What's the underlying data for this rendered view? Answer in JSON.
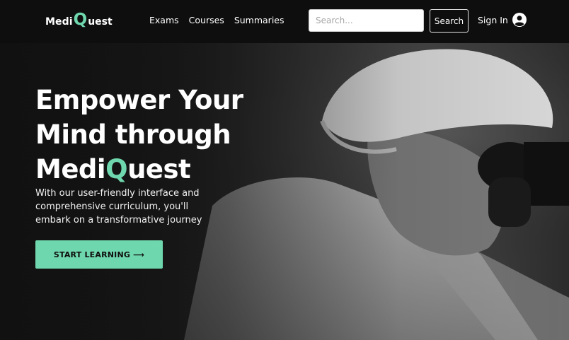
{
  "navbar": {
    "logo": {
      "part1": "Medi",
      "letter": "Q",
      "part2": "uest"
    },
    "links": [
      "Exams",
      "Courses",
      "Summaries"
    ],
    "search": {
      "placeholder": "Search...",
      "value": "",
      "button_label": "Search"
    },
    "signin_label": "Sign In"
  },
  "hero": {
    "title_line1": "Empower Your",
    "title_line2": "Mind through",
    "title_brand_part1": "Medi",
    "title_brand_letter": "Q",
    "title_brand_part2": "uest",
    "subtitle": "With our user-friendly interface and comprehensive curriculum, you'll embark on a transformative journey",
    "cta_label": "START LEARNING",
    "cta_arrow": "⟶"
  },
  "colors": {
    "accent": "#6fd7ae",
    "nav_bg": "#0e0e0e",
    "text": "#ffffff"
  },
  "icons": {
    "user": "user-circle-icon",
    "cta": "arrow-right-icon"
  }
}
